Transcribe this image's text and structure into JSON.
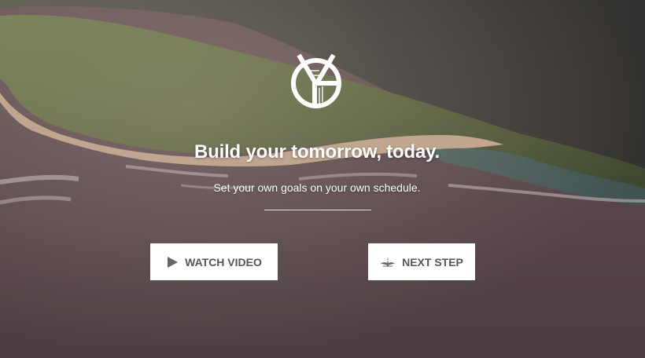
{
  "hero": {
    "headline": "Build your tomorrow, today.",
    "subheadline": "Set your own goals on your own schedule."
  },
  "logo": {
    "icon": "yg-monogram-logo",
    "text": "YG"
  },
  "buttons": {
    "watch_video": {
      "label": "WATCH VIDEO",
      "icon": "play-icon"
    },
    "next_step": {
      "label": "NEXT STEP",
      "icon": "leaf-sprout-icon"
    }
  },
  "colors": {
    "button_bg": "#ffffff",
    "button_text": "#555555",
    "heading_text": "#ffffff"
  }
}
